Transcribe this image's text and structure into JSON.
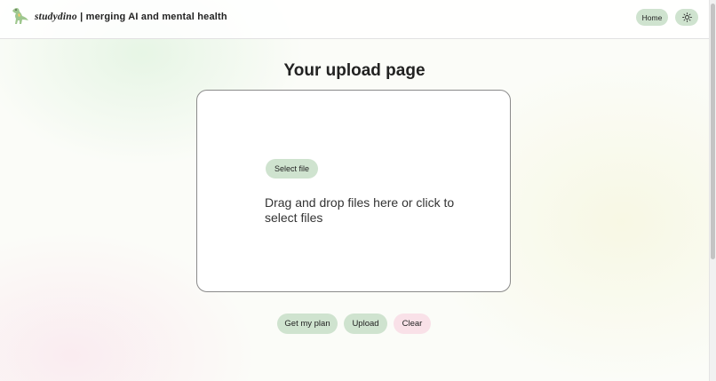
{
  "header": {
    "brand_name": "studydino",
    "brand_tagline": "| merging AI and mental health",
    "logo_icon": "dinosaur-logo-icon",
    "home_label": "Home",
    "theme_icon": "sun-icon"
  },
  "main": {
    "title": "Your upload page",
    "select_label": "Select file",
    "drop_text": "Drag and drop files here or click to select files"
  },
  "actions": {
    "plan_label": "Get my plan",
    "upload_label": "Upload",
    "clear_label": "Clear"
  },
  "colors": {
    "accent_green": "#cfe3cf",
    "accent_pink": "#f9e1e8"
  }
}
